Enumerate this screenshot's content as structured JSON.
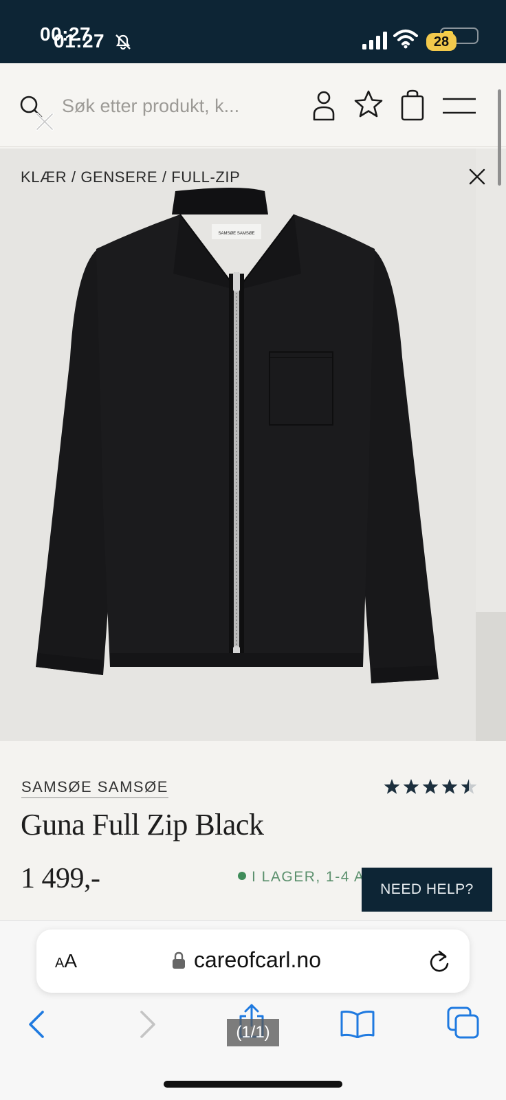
{
  "status_bar": {
    "time_primary": "00:27",
    "time_overlay": "01:27",
    "battery_level": "28",
    "icons": [
      "mute-icon",
      "signal-icon",
      "wifi-icon",
      "battery-icon"
    ]
  },
  "header": {
    "search_placeholder": "Søk etter produkt, k...",
    "icons": [
      "search-icon",
      "close-icon",
      "account-icon",
      "star-icon",
      "bag-icon",
      "menu-icon"
    ]
  },
  "product": {
    "breadcrumb": "KLÆR / GENSERE / FULL-ZIP",
    "brand": "SAMSØE SAMSØE",
    "name": "Guna Full Zip Black",
    "price": "1 499,-",
    "stock": "I LAGER, 1-4 A",
    "rating": 4.5,
    "rating_max": 5,
    "garment_label": "SAMSØE SAMSØE",
    "colors": {
      "stock": "#3f8c5a",
      "rating": "#1c2f3d",
      "garment": "#1b1b1d"
    }
  },
  "chat": {
    "need_help_label": "NEED HELP?"
  },
  "browser": {
    "text_size_small": "A",
    "text_size_large": "A",
    "url": "careofcarl.no",
    "page_counter": "(1/1)",
    "accent": "#1f7ae0",
    "icons": [
      "back-icon",
      "forward-icon",
      "share-icon",
      "bookmarks-icon",
      "tabs-icon",
      "reload-icon",
      "lock-icon"
    ]
  }
}
